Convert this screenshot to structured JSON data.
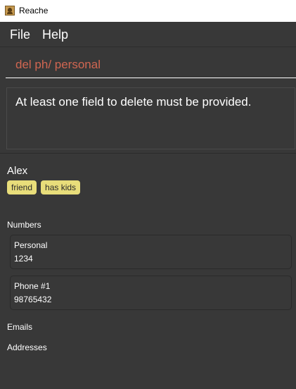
{
  "window": {
    "title": "Reache"
  },
  "menu": {
    "items": [
      "File",
      "Help"
    ]
  },
  "command": {
    "value": "del ph/ personal",
    "text_color": "#d06651"
  },
  "result": {
    "message": "At least one field to delete must be provided."
  },
  "person": {
    "name": "Alex",
    "tags": [
      "friend",
      "has kids"
    ],
    "tag_color": "#e8dd7a",
    "sections": {
      "numbers_label": "Numbers",
      "numbers": [
        {
          "label": "Personal",
          "value": "1234"
        },
        {
          "label": "Phone #1",
          "value": "98765432"
        }
      ],
      "emails_label": "Emails",
      "addresses_label": "Addresses"
    }
  },
  "icons": {
    "app": "contact-book-icon"
  }
}
